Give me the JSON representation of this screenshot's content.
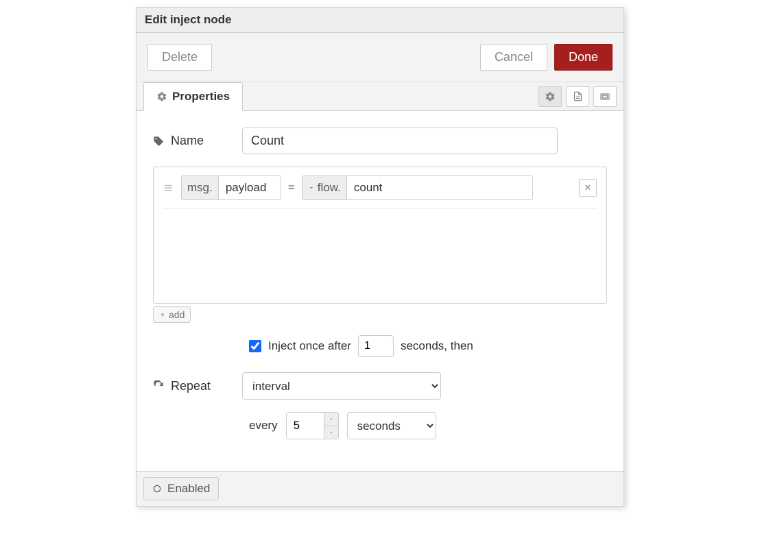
{
  "header": {
    "title": "Edit inject node"
  },
  "buttons": {
    "delete": "Delete",
    "cancel": "Cancel",
    "done": "Done"
  },
  "tabs": {
    "properties": "Properties"
  },
  "form": {
    "name_label": "Name",
    "name_value": "Count",
    "repeat_label": "Repeat"
  },
  "property_row": {
    "msg_prefix": "msg.",
    "msg_field": "payload",
    "equals": "=",
    "flow_prefix": "flow.",
    "flow_field": "count"
  },
  "add_button": "add",
  "inject_once": {
    "checked": true,
    "label_before": "Inject once after",
    "delay": "1",
    "label_after": "seconds, then"
  },
  "repeat": {
    "mode": "interval",
    "every_label": "every",
    "every_value": "5",
    "unit": "seconds"
  },
  "footer": {
    "enabled": "Enabled"
  }
}
